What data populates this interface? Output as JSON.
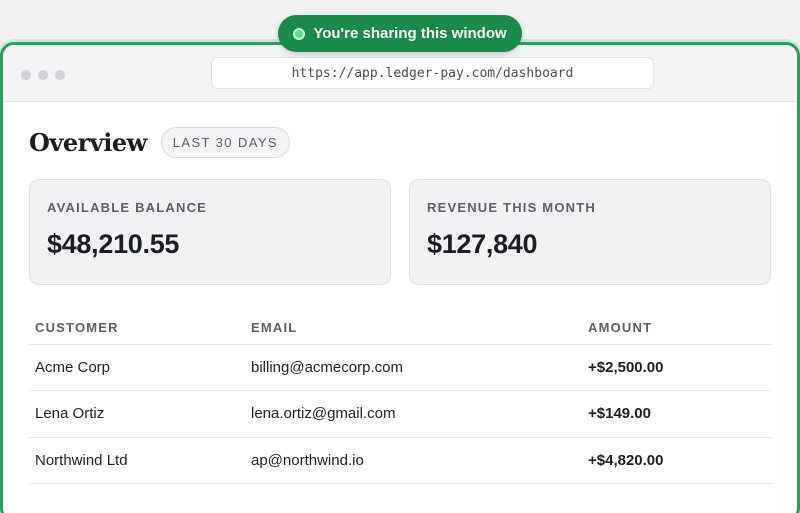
{
  "sharing_banner": {
    "label": "You're sharing this window"
  },
  "browser": {
    "url": "https://app.ledger-pay.com/dashboard"
  },
  "overview": {
    "title": "Overview",
    "range_badge": "LAST 30 DAYS"
  },
  "cards": [
    {
      "label": "AVAILABLE BALANCE",
      "value": "$48,210.55"
    },
    {
      "label": "REVENUE THIS MONTH",
      "value": "$127,840"
    }
  ],
  "table": {
    "headers": {
      "customer": "CUSTOMER",
      "email": "EMAIL",
      "amount": "AMOUNT"
    },
    "rows": [
      {
        "customer": "Acme Corp",
        "email": "billing@acmecorp.com",
        "amount": "+$2,500.00"
      },
      {
        "customer": "Lena Ortiz",
        "email": "lena.ortiz@gmail.com",
        "amount": "+$149.00"
      },
      {
        "customer": "Northwind Ltd",
        "email": "ap@northwind.io",
        "amount": "+$4,820.00"
      }
    ]
  },
  "colors": {
    "sharing_green": "#1a8a4a",
    "frame_green": "#26a05a",
    "indicator_dot": "#5ee08f"
  }
}
